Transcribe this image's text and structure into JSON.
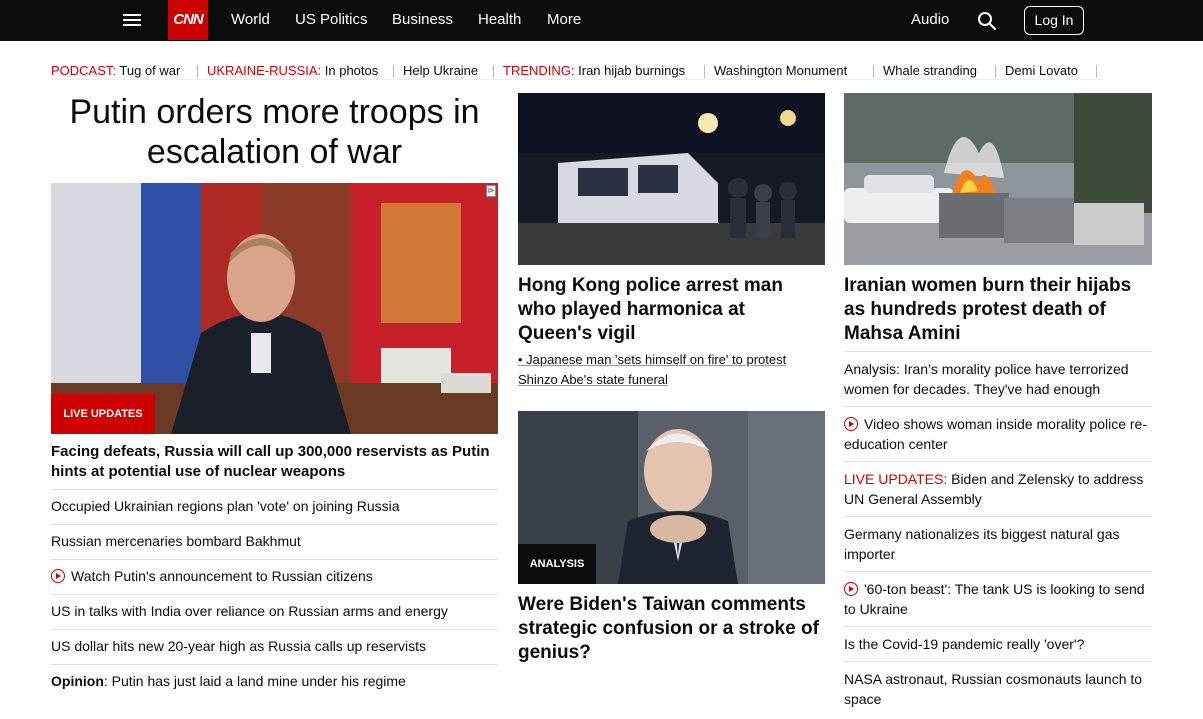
{
  "nav": {
    "logo": "CNN",
    "links": [
      "World",
      "US Politics",
      "Business",
      "Health",
      "More"
    ],
    "audio": "Audio",
    "login": "Log In"
  },
  "trending": {
    "podcast_kicker": "PODCAST:",
    "podcast_text": "Tug of war",
    "ukraine_kicker": "UKRAINE-RUSSIA:",
    "ukraine_text": "In photos",
    "help_ukraine": "Help Ukraine",
    "trending_kicker": "TRENDING:",
    "trending_text": "Iran hijab burnings",
    "item_washington": "Washington Monument",
    "item_whale": "Whale stranding",
    "item_demi": "Demi Lovato"
  },
  "lead": {
    "headline": "Putin orders more troops in escalation of war",
    "badge": "LIVE UPDATES",
    "subheadline": "Facing defeats, Russia will call up 300,000 reservists as Putin hints at potential use of nuclear weapons",
    "ad_mark": "⊳",
    "links": [
      "Occupied Ukrainian regions plan 'vote' on joining Russia",
      "Russian mercenaries bombard Bakhmut",
      "Watch Putin's announcement to Russian citizens",
      "US in talks with India over reliance on Russian arms and energy",
      "US dollar hits new 20-year high as Russia calls up reservists"
    ],
    "opinion_kicker": "Opinion",
    "opinion_text": ": Putin has just laid a land mine under his regime"
  },
  "middle": {
    "hk_headline": "Hong Kong police arrest man who played harmonica at Queen's vigil",
    "hk_sub": "• Japanese man 'sets himself on fire' to protest Shinzo Abe's state funeral",
    "analysis_badge": "ANALYSIS",
    "biden_headline": "Were Biden's Taiwan comments strategic confusion or a stroke of genius?"
  },
  "right": {
    "iran_headline": "Iranian women burn their hijabs as hundreds protest death of Mahsa Amini",
    "links": [
      "Analysis: Iran’s morality police have terrorized women for decades. They've had enough",
      "Video shows woman inside morality police re-education center",
      "Biden and Zelensky to address UN General Assembly",
      "Germany nationalizes its biggest natural gas importer",
      "'60-ton beast': The tank US is looking to send to Ukraine",
      "Is the Covid-19 pandemic really 'over'?",
      "NASA astronaut, Russian cosmonauts launch to space"
    ],
    "live_kicker": "LIVE UPDATES:"
  },
  "colors": {
    "accent": "#cc0000",
    "nav_bg": "#0c0c0c"
  }
}
